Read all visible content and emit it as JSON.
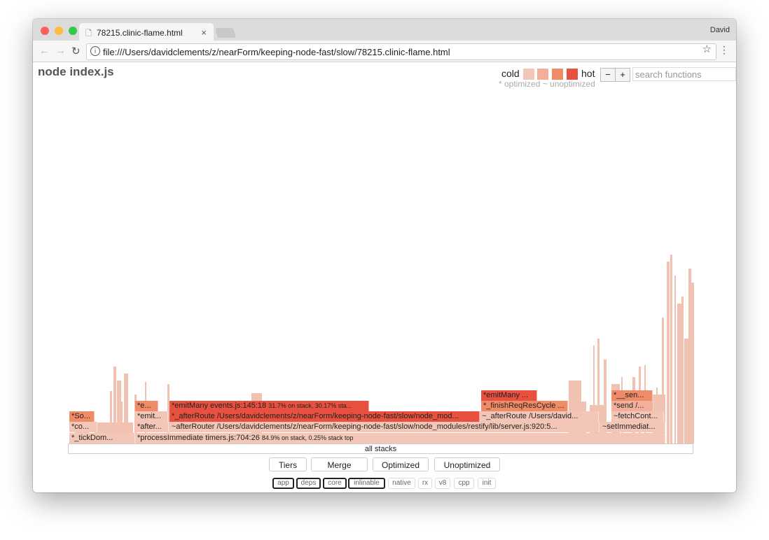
{
  "browser": {
    "tab_title": "78215.clinic-flame.html",
    "user": "David",
    "url": "file:///Users/davidclements/z/nearForm/keeping-node-fast/slow/78215.clinic-flame.html"
  },
  "header": {
    "title": "node index.js",
    "legend_cold": "cold",
    "legend_hot": "hot",
    "legend_hint": "* optimized ~ unoptimized",
    "zoom_out": "−",
    "zoom_in": "+",
    "search_placeholder": "search functions",
    "heat_colors": [
      "#f3c6b7",
      "#f2b09b",
      "#ef8c67",
      "#e8503f"
    ]
  },
  "flame": {
    "root": "all stacks",
    "frames": {
      "tickDom": "*_tickDom...",
      "processImmediate": "*processImmediate timers.js:704:26",
      "processImmediate_stats": "84.9% on stack, 0.25% stack top",
      "co": "*co...",
      "after": "*after...",
      "afterRouter": "~afterRouter /Users/davidclements/z/nearForm/keeping-node-fast/slow/node_modules/restify/lib/server.js:920:5...",
      "setImmediat": "~setImmediat...",
      "so": "*So...",
      "emit": "*emit...",
      "afterRoute_opt": "*_afterRoute /Users/davidclements/z/nearForm/keeping-node-fast/slow/node_mod...",
      "afterRoute_unopt": "~_afterRoute /Users/david...",
      "fetchCont": "~fetchCont...",
      "e": "*e...",
      "emitMany": "*emitMany events.js:145:18",
      "emitMany_stats": "31.7% on stack, 30.17% sta...",
      "finishReq": "*_finishReqResCycle ...",
      "send": "*send /...",
      "emitMany2": "*emitMany ...",
      "sen": "*__sen..."
    }
  },
  "controls": {
    "buttons": [
      "Tiers",
      "Merge",
      "Optimized",
      "Unoptimized"
    ],
    "filters": [
      {
        "label": "app",
        "on": true
      },
      {
        "label": "deps",
        "on": true
      },
      {
        "label": "core",
        "on": true
      },
      {
        "label": "inlinable",
        "on": true
      },
      {
        "label": "native",
        "on": false
      },
      {
        "label": "rx",
        "on": false
      },
      {
        "label": "v8",
        "on": false
      },
      {
        "label": "cpp",
        "on": false
      },
      {
        "label": "init",
        "on": false
      }
    ]
  }
}
